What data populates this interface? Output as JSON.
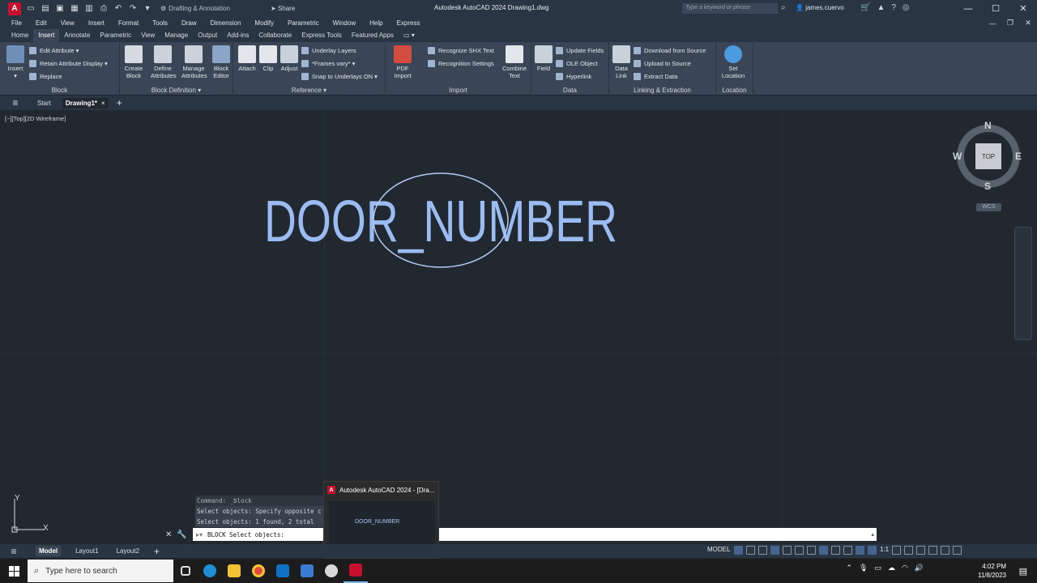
{
  "titlebar": {
    "workspace": "Drafting & Annotation",
    "share": "Share",
    "title": "Autodesk AutoCAD 2024   Drawing1.dwg",
    "search_placeholder": "Type a keyword or phrase",
    "user": "james.cuervo"
  },
  "menu": [
    "File",
    "Edit",
    "View",
    "Insert",
    "Format",
    "Tools",
    "Draw",
    "Dimension",
    "Modify",
    "Parametric",
    "Window",
    "Help",
    "Express"
  ],
  "ribbon_tabs": [
    "Home",
    "Insert",
    "Annotate",
    "Parametric",
    "View",
    "Manage",
    "Output",
    "Add-ins",
    "Collaborate",
    "Express Tools",
    "Featured Apps"
  ],
  "ribbon": {
    "block": {
      "title": "Block",
      "insert": "Insert",
      "edit_attribute": "Edit Attribute",
      "retain_attribute_display": "Retain Attribute Display",
      "replace": "Replace"
    },
    "block_definition": {
      "title": "Block Definition",
      "create_block": "Create Block",
      "define_attributes": "Define Attributes",
      "manage_attributes": "Manage Attributes",
      "block_editor": "Block Editor"
    },
    "reference": {
      "title": "Reference",
      "attach": "Attach",
      "clip": "Clip",
      "adjust": "Adjust",
      "underlay_layers": "Underlay Layers",
      "frames_vary": "*Frames vary*",
      "snap_to_underlays": "Snap to Underlays ON"
    },
    "import": {
      "title": "Import",
      "pdf_import": "PDF Import",
      "recognize_shx": "Recognize SHX Text",
      "recognition_settings": "Recognition Settings",
      "combine_text": "Combine Text"
    },
    "data": {
      "title": "Data",
      "field": "Field",
      "update_fields": "Update Fields",
      "ole_object": "OLE Object",
      "hyperlink": "Hyperlink"
    },
    "linking": {
      "title": "Linking & Extraction",
      "data_link": "Data Link",
      "download_from_source": "Download from Source",
      "upload_to_source": "Upload to Source",
      "extract_data": "Extract  Data"
    },
    "location": {
      "title": "Location",
      "set_location": "Set Location"
    }
  },
  "file_tabs": {
    "start": "Start",
    "drawing": "Drawing1*"
  },
  "canvas": {
    "view_label": "[−][Top][2D Wireframe]",
    "attribute_text": "DOOR_NUMBER",
    "viewcube": {
      "top": "TOP",
      "n": "N",
      "s": "S",
      "e": "E",
      "w": "W",
      "wcs": "WCS"
    },
    "ucs": {
      "x": "X",
      "y": "Y"
    }
  },
  "command": {
    "history": [
      "Command: _block",
      "Select objects: Specify opposite c",
      "Select objects: 1 found, 2 total"
    ],
    "prompt": "BLOCK Select objects:"
  },
  "preview": {
    "title": "Autodesk AutoCAD 2024 - [Dra...",
    "thumb_text": "DOOR_NUMBER"
  },
  "layout_tabs": [
    "Model",
    "Layout1",
    "Layout2"
  ],
  "status": {
    "model": "MODEL",
    "scale": "1:1"
  },
  "taskbar": {
    "search_placeholder": "Type here to search",
    "time": "4:02 PM",
    "date": "11/8/2023"
  },
  "colors": {
    "accent": "#6fa8f5",
    "attribute_text": "#9bbcf3",
    "canvas_bg": "#212830",
    "ribbon_bg": "#3a4656"
  }
}
